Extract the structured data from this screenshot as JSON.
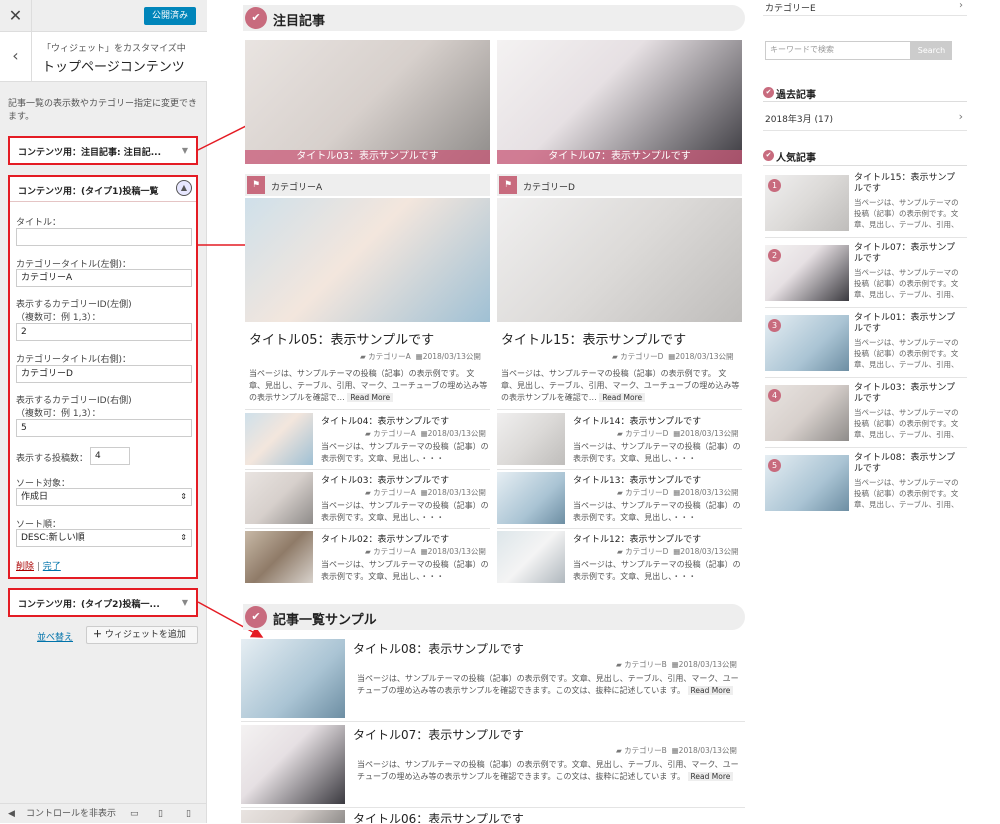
{
  "customizer": {
    "close_label": "✕",
    "publish_label": "公開済み",
    "back_label": "‹",
    "breadcrumb": "「ウィジェット」をカスタマイズ中",
    "title": "トップページコンテンツ",
    "description": "記事一覧の表示数やカテゴリー指定に変更できます。",
    "widget1_title": "コンテンツ用：注目記事: 注目記...",
    "widget2_title": "コンテンツ用：(タイプ1)投稿一覧",
    "widget3_title": "コンテンツ用：(タイプ2)投稿一...",
    "form": {
      "title_label": "タイトル：",
      "title_value": "",
      "cat_left_label": "カテゴリータイトル(左側)：",
      "cat_left_value": "カテゴリーA",
      "cat_left_id_label": "表示するカテゴリーID(左側)",
      "cat_left_id_hint": "（複数可：例 1,3）：",
      "cat_left_id_value": "2",
      "cat_right_label": "カテゴリータイトル(右側)：",
      "cat_right_value": "カテゴリーD",
      "cat_right_id_label": "表示するカテゴリーID(右側)",
      "cat_right_id_hint": "（複数可：例 1,3）：",
      "cat_right_id_value": "5",
      "count_label": "表示する投稿数：",
      "count_value": "4",
      "sort_target_label": "ソート対象：",
      "sort_target_value": "作成日",
      "sort_order_label": "ソート順：",
      "sort_order_value": "DESC:新しい順",
      "delete_label": "削除",
      "separator": " | ",
      "done_label": "完了"
    },
    "reorder_label": "並べ替え",
    "add_widget_label": "ウィジェットを追加",
    "hide_controls_label": "コントロールを非表示"
  },
  "main": {
    "featured_heading": "注目記事",
    "featured": [
      {
        "caption": "タイトル03：表示サンプルです"
      },
      {
        "caption": "タイトル07：表示サンプルです"
      }
    ],
    "left_col": {
      "category": "カテゴリーA",
      "title": "タイトル05：表示サンプルです",
      "meta_cat": "カテゴリーA",
      "meta_date": "2018/03/13公開",
      "excerpt": "当ページは、サンプルテーマの投稿（記事）の表示例です。 文章、見出し、テーブル、引用、マーク、ユーチューブの埋め込み等の表示サンプルを確認で…",
      "read_more": "Read More",
      "items": [
        {
          "title": "タイトル04：表示サンプルです",
          "cat": "カテゴリーA",
          "date": "2018/03/13公開",
          "excerpt": "当ページは、サンプルテーマの投稿（記事）の表示例です。文章、見出し、・・・"
        },
        {
          "title": "タイトル03：表示サンプルです",
          "cat": "カテゴリーA",
          "date": "2018/03/13公開",
          "excerpt": "当ページは、サンプルテーマの投稿（記事）の表示例です。文章、見出し、・・・"
        },
        {
          "title": "タイトル02：表示サンプルです",
          "cat": "カテゴリーA",
          "date": "2018/03/13公開",
          "excerpt": "当ページは、サンプルテーマの投稿（記事）の表示例です。文章、見出し、・・・"
        }
      ]
    },
    "right_col": {
      "category": "カテゴリーD",
      "title": "タイトル15：表示サンプルです",
      "meta_cat": "カテゴリーD",
      "meta_date": "2018/03/13公開",
      "excerpt": "当ページは、サンプルテーマの投稿（記事）の表示例です。 文章、見出し、テーブル、引用、マーク、ユーチューブの埋め込み等の表示サンプルを確認で…",
      "read_more": "Read More",
      "items": [
        {
          "title": "タイトル14：表示サンプルです",
          "cat": "カテゴリーD",
          "date": "2018/03/13公開",
          "excerpt": "当ページは、サンプルテーマの投稿（記事）の表示例です。文章、見出し、・・・"
        },
        {
          "title": "タイトル13：表示サンプルです",
          "cat": "カテゴリーD",
          "date": "2018/03/13公開",
          "excerpt": "当ページは、サンプルテーマの投稿（記事）の表示例です。文章、見出し、・・・"
        },
        {
          "title": "タイトル12：表示サンプルです",
          "cat": "カテゴリーD",
          "date": "2018/03/13公開",
          "excerpt": "当ページは、サンプルテーマの投稿（記事）の表示例です。文章、見出し、・・・"
        }
      ]
    },
    "list_heading": "記事一覧サンプル",
    "list": [
      {
        "title": "タイトル08：表示サンプルです",
        "cat": "カテゴリーB",
        "date": "2018/03/13公開",
        "excerpt": "当ページは、サンプルテーマの投稿（記事）の表示例です。文章、見出し、テーブル、引用、マーク、ユーチューブの埋め込み等の表示サンプルを確認できます。この文は、抜粋に記述していま す。",
        "read_more": "Read More"
      },
      {
        "title": "タイトル07：表示サンプルです",
        "cat": "カテゴリーB",
        "date": "2018/03/13公開",
        "excerpt": "当ページは、サンプルテーマの投稿（記事）の表示例です。文章、見出し、テーブル、引用、マーク、ユーチューブの埋め込み等の表示サンプルを確認できます。この文は、抜粋に記述していま す。",
        "read_more": "Read More"
      },
      {
        "title": "タイトル06：表示サンプルです"
      }
    ]
  },
  "right": {
    "category_e": "カテゴリーE",
    "search_placeholder": "キーワードで検索",
    "search_button": "Search",
    "archive_heading": "過去記事",
    "archive_item": "2018年3月 (17)",
    "popular_heading": "人気記事",
    "popular": [
      {
        "rank": "1",
        "title": "タイトル15：表示サンプルです",
        "excerpt": "当ページは、サンプルテーマの投稿（記事）の表示例です。文章、見出し、テーブル、引用、マーク、ユーチ…"
      },
      {
        "rank": "2",
        "title": "タイトル07：表示サンプルです",
        "excerpt": "当ページは、サンプルテーマの投稿（記事）の表示例です。文章、見出し、テーブル、引用、マーク、ユーチ…"
      },
      {
        "rank": "3",
        "title": "タイトル01：表示サンプルです",
        "excerpt": "当ページは、サンプルテーマの投稿（記事）の表示例です。文章、見出し、テーブル、引用、マーク、ユーチ…"
      },
      {
        "rank": "4",
        "title": "タイトル03：表示サンプルです",
        "excerpt": "当ページは、サンプルテーマの投稿（記事）の表示例です。文章、見出し、テーブル、引用、マーク、ユーチ…"
      },
      {
        "rank": "5",
        "title": "タイトル08：表示サンプルです",
        "excerpt": "当ページは、サンプルテーマの投稿（記事）の表示例です。文章、見出し、テーブル、引用、マーク、ユーチ…"
      }
    ]
  }
}
